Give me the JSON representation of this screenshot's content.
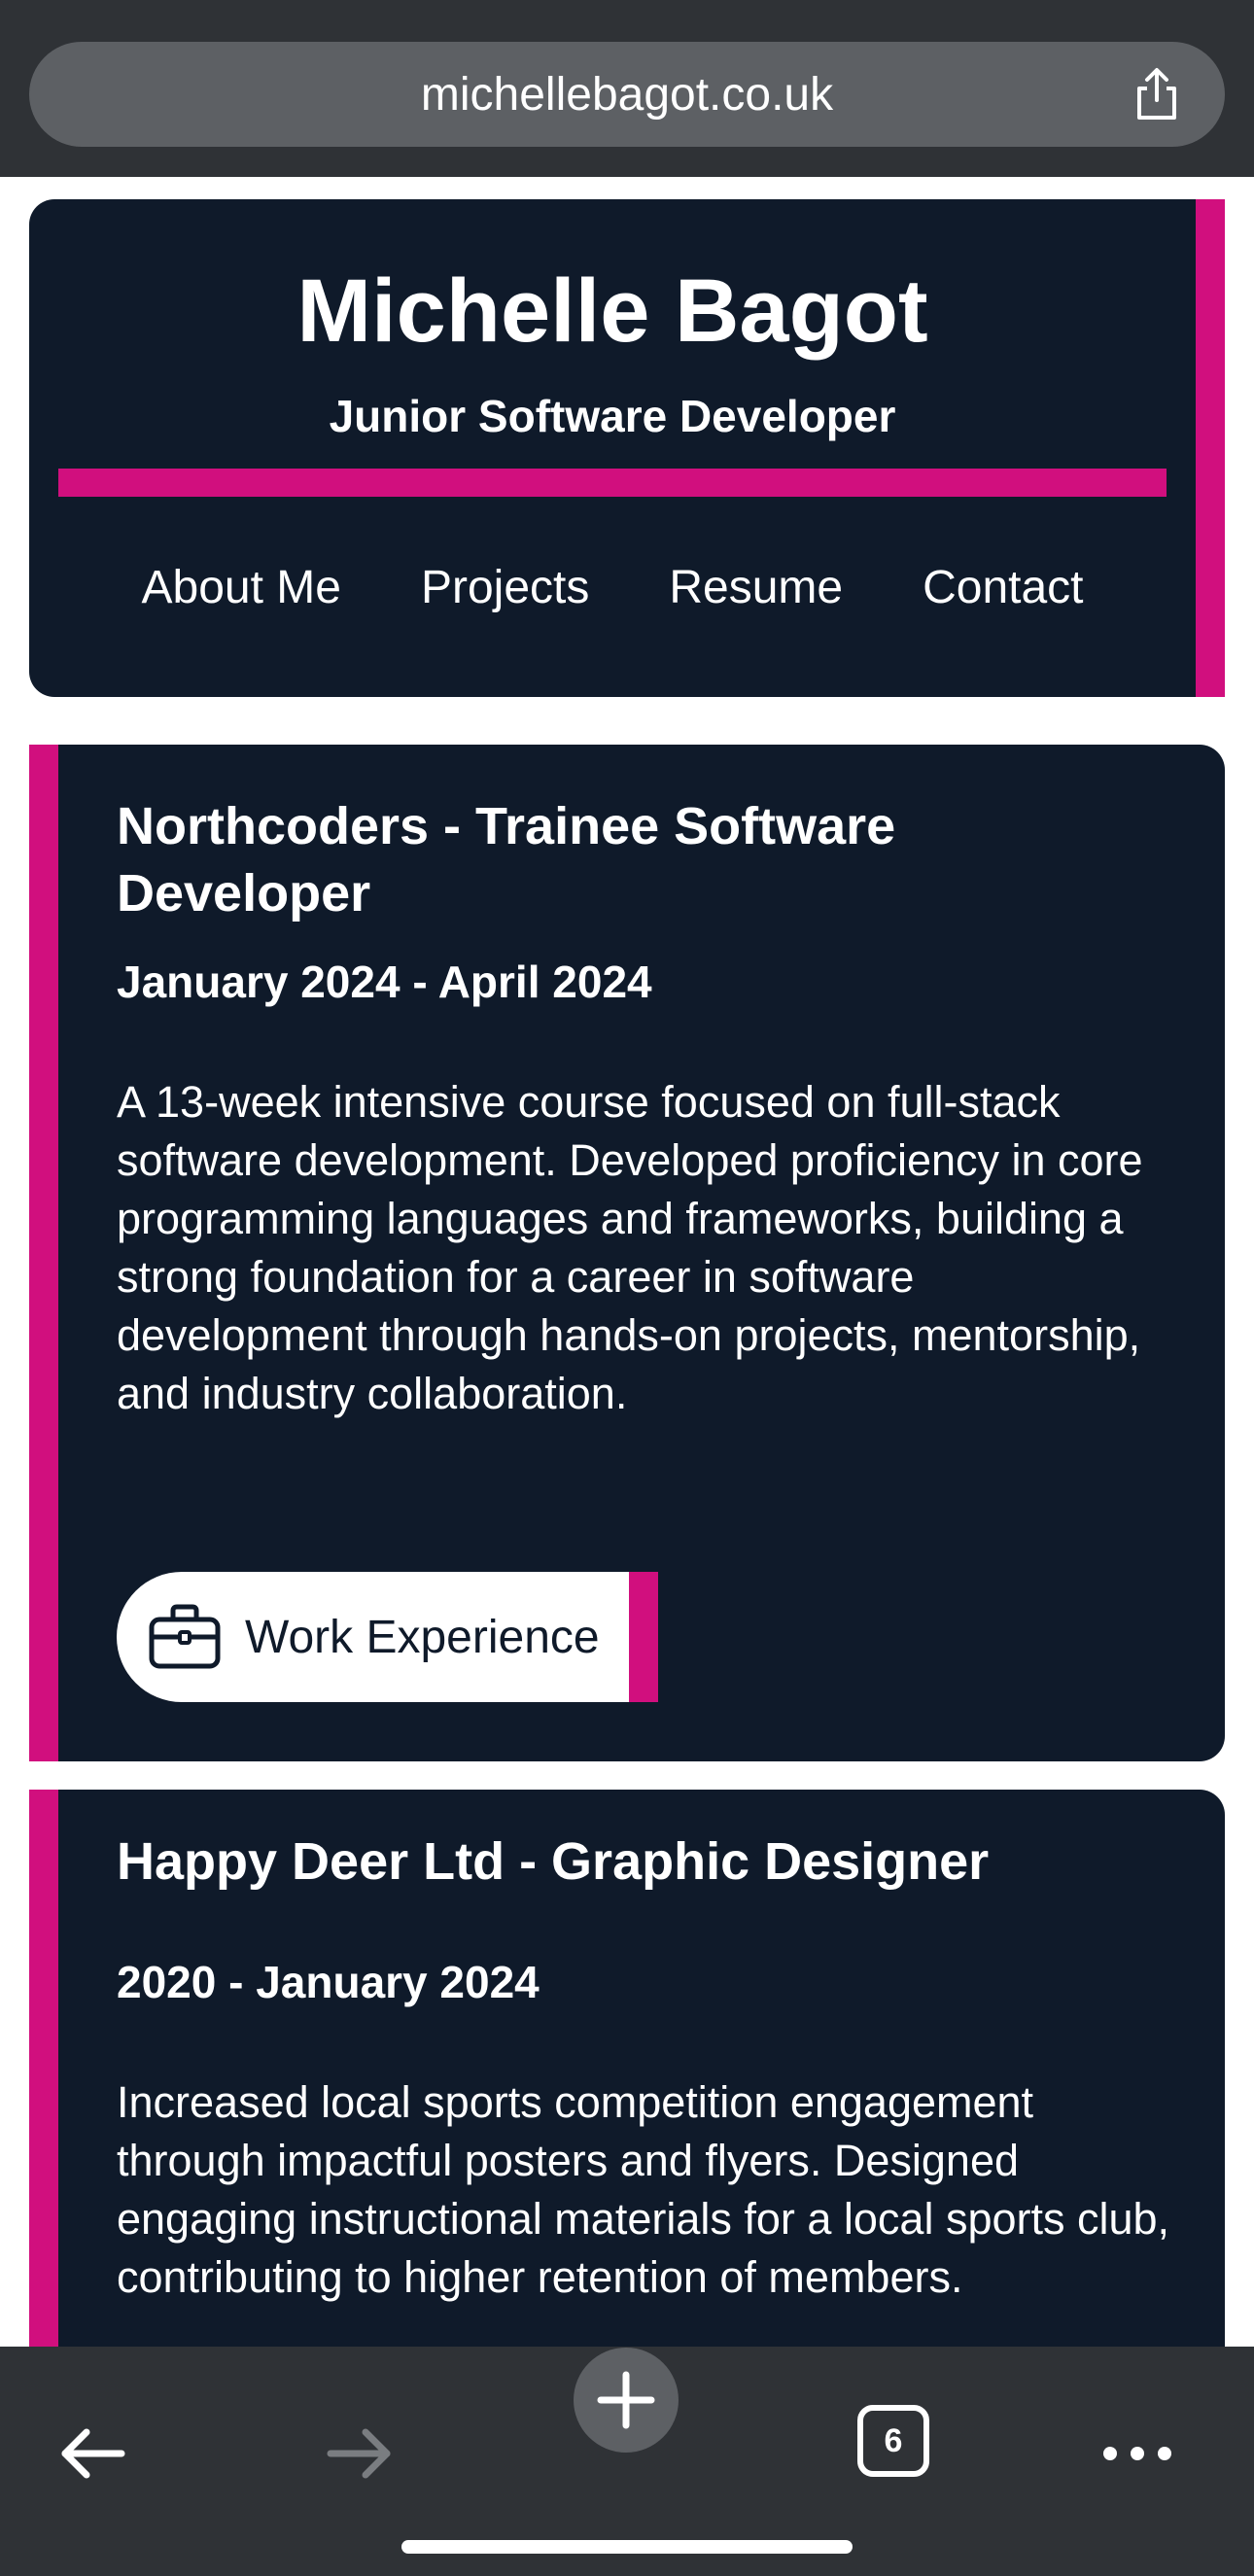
{
  "browser": {
    "url": "michellebagot.co.uk",
    "tab_count": "6"
  },
  "header": {
    "name": "Michelle Bagot",
    "role": "Junior Software Developer",
    "nav": [
      "About Me",
      "Projects",
      "Resume",
      "Contact"
    ]
  },
  "experience": [
    {
      "title": "Northcoders - Trainee Software Developer",
      "dates": "January 2024 - April 2024",
      "description": "A 13-week intensive course focused on full-stack software development. Developed proficiency in core programming languages and frameworks, building a strong foundation for a career in software development through hands-on projects, mentorship, and industry collaboration.",
      "tag_label": "Work Experience",
      "tag_icon": "briefcase-icon"
    },
    {
      "title": "Happy Deer Ltd - Graphic Designer",
      "dates": "2020 - January 2024",
      "description": "Increased local sports competition engagement through impactful posters and flyers. Designed engaging instructional materials for a local sports club, contributing to higher retention of members."
    }
  ],
  "colors": {
    "navy": "#0f1a2a",
    "accent": "#d10f7e",
    "browser_chrome": "#2f3236"
  },
  "icons": [
    "share-icon",
    "back-icon",
    "forward-icon",
    "new-tab-icon",
    "tabs-icon",
    "more-icon"
  ]
}
